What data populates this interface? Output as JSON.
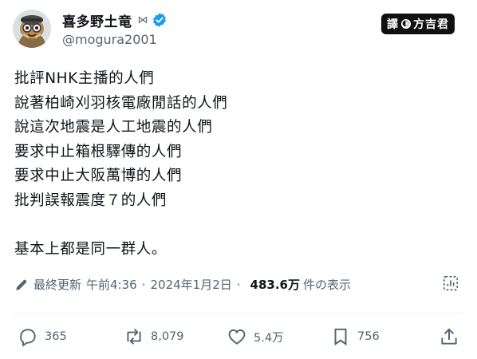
{
  "author": {
    "display_name": "喜多野土竜",
    "badge": "⋈",
    "handle": "@mogura2001",
    "verified_color": "#1d9bf0"
  },
  "watermark": {
    "prefix": "譯",
    "mark": "◐",
    "name": "方吉君"
  },
  "tweet": {
    "lines": [
      "批評NHK主播的人們",
      "說著柏崎刈羽核電廠閒話的人們",
      "說這次地震是人工地震的人們",
      "要求中止箱根驛傳的人們",
      "要求中止大阪萬博的人們",
      "批判誤報震度７的人們",
      "",
      "基本上都是同一群人。"
    ]
  },
  "meta": {
    "edited_label": "最終更新",
    "time": "午前4:36",
    "separator": "·",
    "date": "2024年1月2日",
    "views": "483.6万",
    "views_label": "件の表示"
  },
  "actions": {
    "replies": "365",
    "reposts": "8,079",
    "likes": "5.4万",
    "bookmarks": "756"
  },
  "colors": {
    "text": "#0f1419",
    "secondary": "#536471",
    "accent": "#1d9bf0"
  }
}
